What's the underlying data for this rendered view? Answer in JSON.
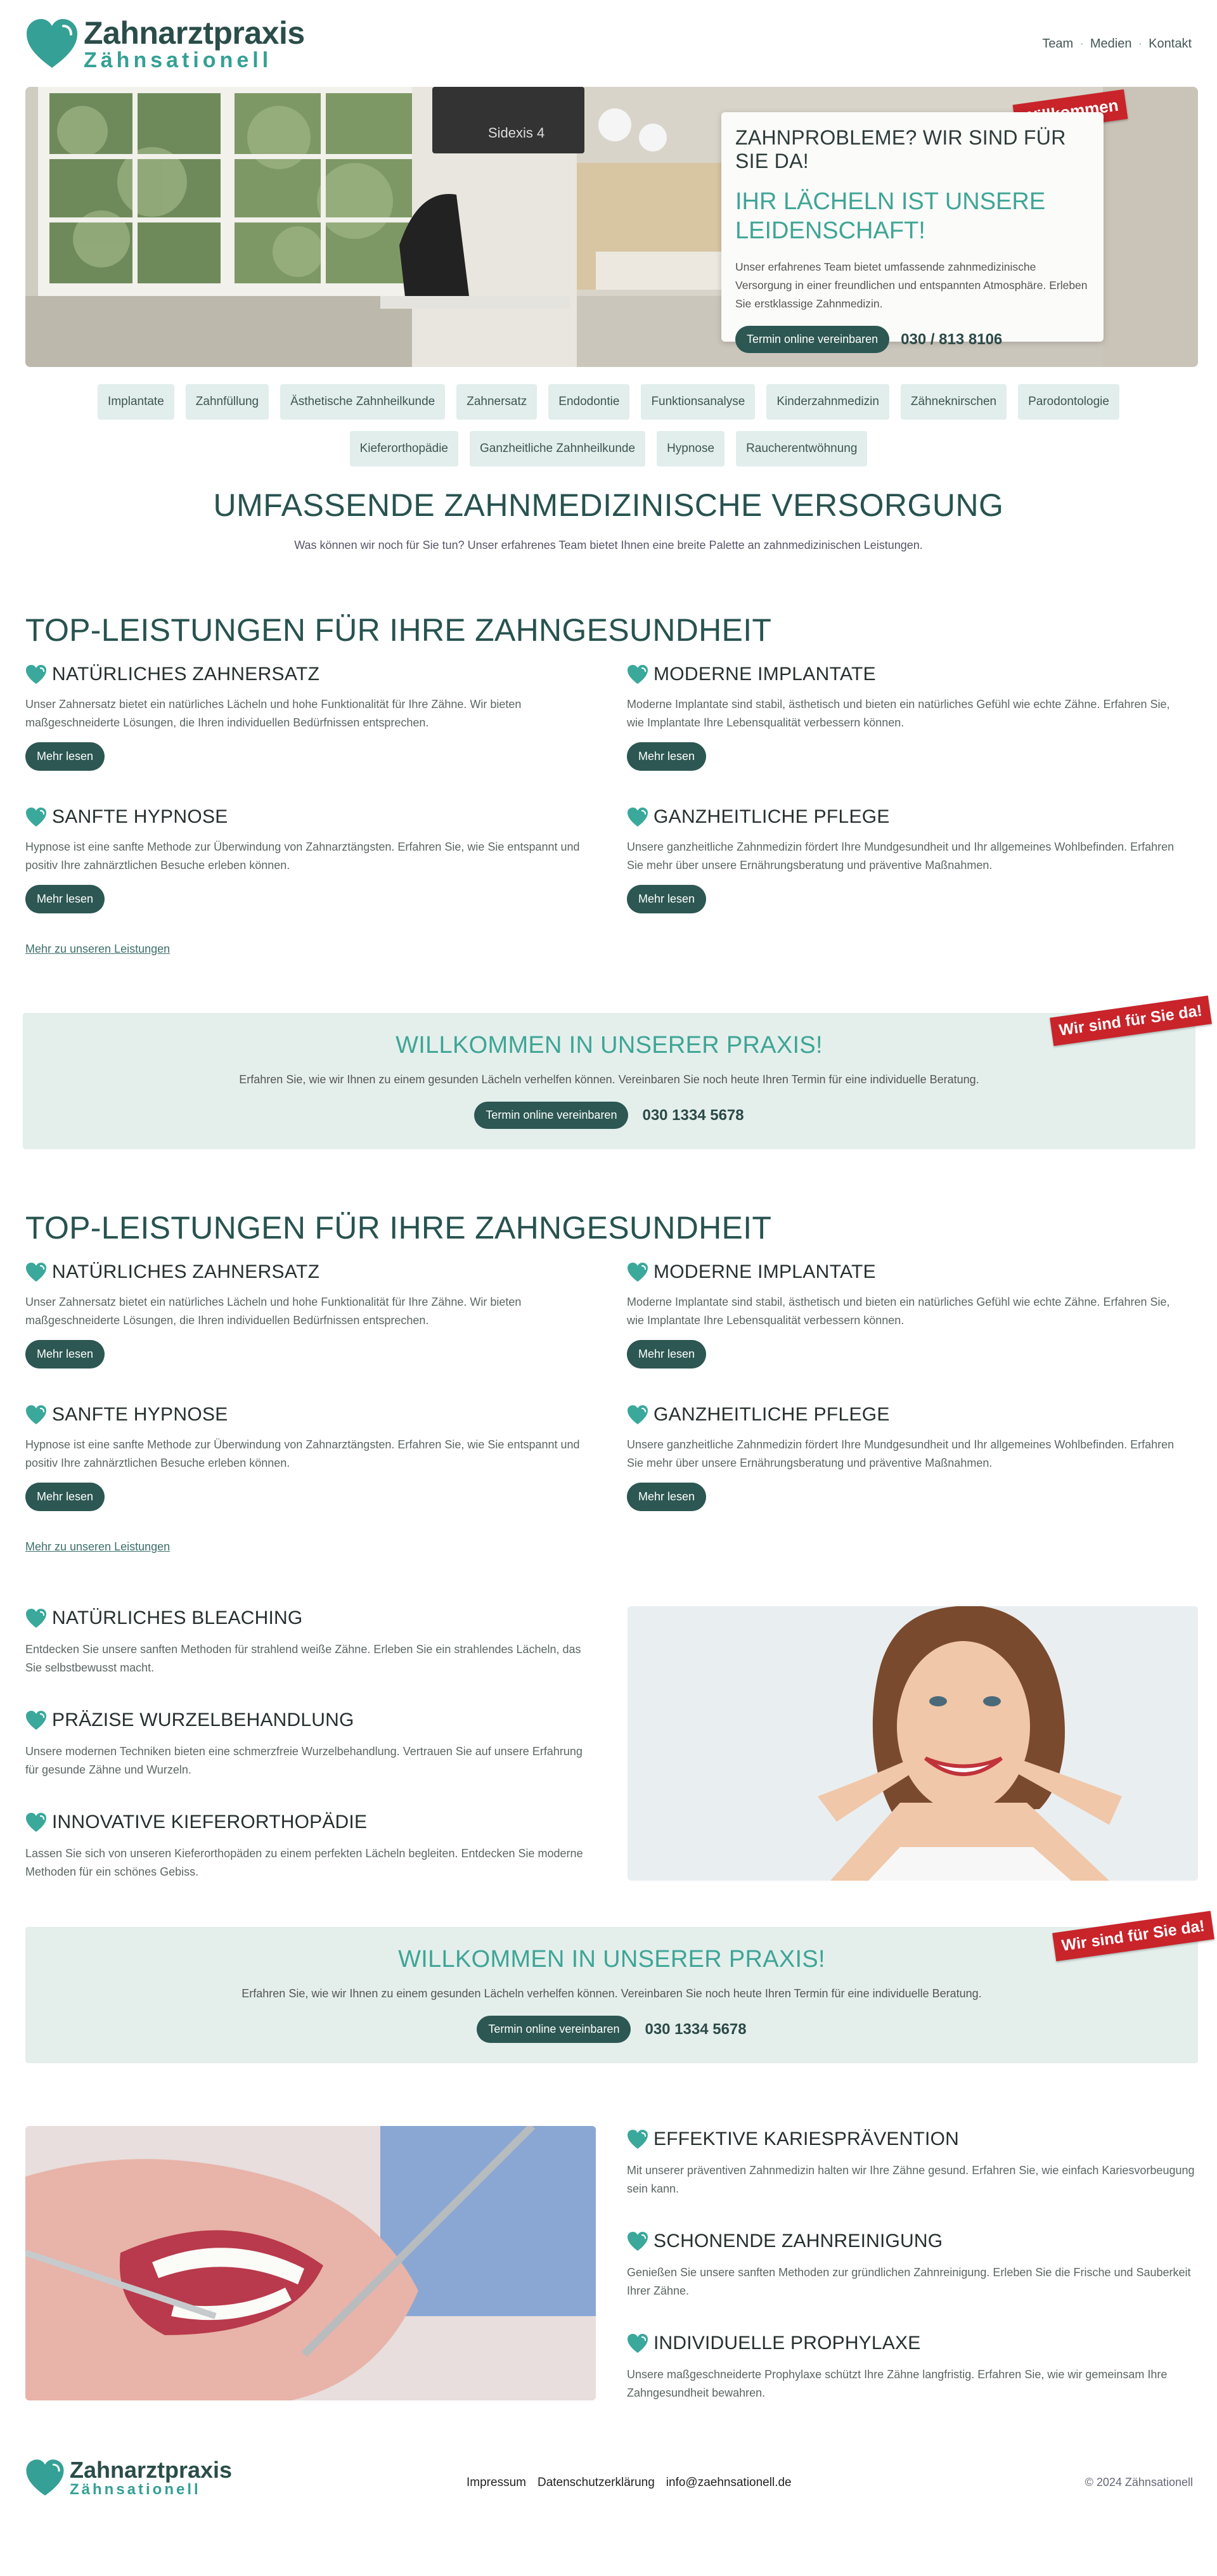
{
  "brand": {
    "name": "Zahnarztpraxis",
    "tagline": "Zähnsationell",
    "accent": "#35a095",
    "dark": "#2c5752"
  },
  "nav": {
    "items": [
      "Team",
      "Medien",
      "Kontakt"
    ]
  },
  "hero": {
    "image_text": "Sidexis 4",
    "ribbon": "Willkommen",
    "kicker": "ZAHNPROBLEME? WIR SIND FÜR SIE DA!",
    "headline": "IHR LÄCHELN IST UNSERE LEIDENSCHAFT!",
    "text": "Unser erfahrenes Team bietet umfassende zahnmedizinische Versorgung in einer freundlichen und entspannten Atmosphäre. Erleben Sie erstklassige Zahnmedizin.",
    "button": "Termin online vereinbaren",
    "phone": "030 / 813 8106"
  },
  "tags": [
    "Implantate",
    "Zahnfüllung",
    "Ästhetische Zahnheilkunde",
    "Zahnersatz",
    "Endodontie",
    "Funktionsanalyse",
    "Kinderzahnmedizin",
    "Zähneknirschen",
    "Parodontologie",
    "Kieferorthopädie",
    "Ganzheitliche Zahnheilkunde",
    "Hypnose",
    "Raucherentwöhnung"
  ],
  "overview": {
    "title": "UMFASSENDE ZAHNMEDIZINISCHE VERSORGUNG",
    "subtitle": "Was können wir noch für Sie tun? Unser erfahrenes Team bietet Ihnen eine breite Palette an zahnmedizinischen Leistungen."
  },
  "top1": {
    "title": "TOP-LEISTUNGEN FÜR IHRE ZAHNGESUNDHEIT",
    "services": [
      {
        "title": "NATÜRLICHES ZAHNERSATZ",
        "text": "Unser Zahnersatz bietet ein natürliches Lächeln und hohe Funktionalität für Ihre Zähne. Wir bieten maßgeschneiderte Lösungen, die Ihren individuellen Bedürfnissen entsprechen.",
        "button": "Mehr lesen"
      },
      {
        "title": "MODERNE IMPLANTATE",
        "text": "Moderne Implantate sind stabil, ästhetisch und bieten ein natürliches Gefühl wie echte Zähne. Erfahren Sie, wie Implantate Ihre Lebensqualität verbessern können.",
        "button": "Mehr lesen"
      },
      {
        "title": "SANFTE HYPNOSE",
        "text": "Hypnose ist eine sanfte Methode zur Überwindung von Zahnarztängsten. Erfahren Sie, wie Sie entspannt und positiv Ihre zahnärztlichen Besuche erleben können.",
        "button": "Mehr lesen"
      },
      {
        "title": "GANZHEITLICHE PFLEGE",
        "text": "Unsere ganzheitliche Zahnmedizin fördert Ihre Mundgesundheit und Ihr allgemeines Wohlbefinden. Erfahren Sie mehr über unsere Ernährungsberatung und präventive Maßnahmen.",
        "button": "Mehr lesen"
      }
    ],
    "more_link": "Mehr zu unseren Leistungen"
  },
  "welcome1": {
    "ribbon": "Wir sind für Sie da!",
    "title": "WILLKOMMEN IN UNSERER PRAXIS!",
    "text": "Erfahren Sie, wie wir Ihnen zu einem gesunden Lächeln verhelfen können. Vereinbaren Sie noch heute Ihren Termin für eine individuelle Beratung.",
    "button": "Termin online vereinbaren",
    "phone": "030 1334 5678"
  },
  "top2": {
    "title": "TOP-LEISTUNGEN FÜR IHRE ZAHNGESUNDHEIT",
    "services": [
      {
        "title": "NATÜRLICHES ZAHNERSATZ",
        "text": "Unser Zahnersatz bietet ein natürliches Lächeln und hohe Funktionalität für Ihre Zähne. Wir bieten maßgeschneiderte Lösungen, die Ihren individuellen Bedürfnissen entsprechen.",
        "button": "Mehr lesen"
      },
      {
        "title": "MODERNE IMPLANTATE",
        "text": "Moderne Implantate sind stabil, ästhetisch und bieten ein natürliches Gefühl wie echte Zähne. Erfahren Sie, wie Implantate Ihre Lebensqualität verbessern können.",
        "button": "Mehr lesen"
      },
      {
        "title": "SANFTE HYPNOSE",
        "text": "Hypnose ist eine sanfte Methode zur Überwindung von Zahnarztängsten. Erfahren Sie, wie Sie entspannt und positiv Ihre zahnärztlichen Besuche erleben können.",
        "button": "Mehr lesen"
      },
      {
        "title": "GANZHEITLICHE PFLEGE",
        "text": "Unsere ganzheitliche Zahnmedizin fördert Ihre Mundgesundheit und Ihr allgemeines Wohlbefinden. Erfahren Sie mehr über unsere Ernährungsberatung und präventive Maßnahmen.",
        "button": "Mehr lesen"
      }
    ],
    "more_link": "Mehr zu unseren Leistungen"
  },
  "features1": [
    {
      "title": "NATÜRLICHES BLEACHING",
      "text": "Entdecken Sie unsere sanften Methoden für strahlend weiße Zähne. Erleben Sie ein strahlendes Lächeln, das Sie selbstbewusst macht."
    },
    {
      "title": "PRÄZISE WURZELBEHANDLUNG",
      "text": "Unsere modernen Techniken bieten eine schmerzfreie Wurzelbehandlung. Vertrauen Sie auf unsere Erfahrung für gesunde Zähne und Wurzeln."
    },
    {
      "title": "INNOVATIVE KIEFERORTHOPÄDIE",
      "text": "Lassen Sie sich von unseren Kieferorthopäden zu einem perfekten Lächeln begleiten. Entdecken Sie moderne Methoden für ein schönes Gebiss."
    }
  ],
  "welcome2": {
    "ribbon": "Wir sind für Sie da!",
    "title": "WILLKOMMEN IN UNSERER PRAXIS!",
    "text": "Erfahren Sie, wie wir Ihnen zu einem gesunden Lächeln verhelfen können. Vereinbaren Sie noch heute Ihren Termin für eine individuelle Beratung.",
    "button": "Termin online vereinbaren",
    "phone": "030 1334 5678"
  },
  "features2": [
    {
      "title": "EFFEKTIVE KARIESPRÄVENTION",
      "text": "Mit unserer präventiven Zahnmedizin halten wir Ihre Zähne gesund. Erfahren Sie, wie einfach Kariesvorbeugung sein kann."
    },
    {
      "title": "SCHONENDE ZAHNREINIGUNG",
      "text": "Genießen Sie unsere sanften Methoden zur gründlichen Zahnreinigung. Erleben Sie die Frische und Sauberkeit Ihrer Zähne."
    },
    {
      "title": "INDIVIDUELLE PROPHYLAXE",
      "text": "Unsere maßgeschneiderte Prophylaxe schützt Ihre Zähne langfristig. Erfahren Sie, wie wir gemeinsam Ihre Zahngesundheit bewahren."
    }
  ],
  "footer": {
    "links": [
      "Impressum",
      "Datenschutzerklärung",
      "info@zaehnsationell.de"
    ],
    "copyright": "© 2024 Zähnsationell"
  }
}
